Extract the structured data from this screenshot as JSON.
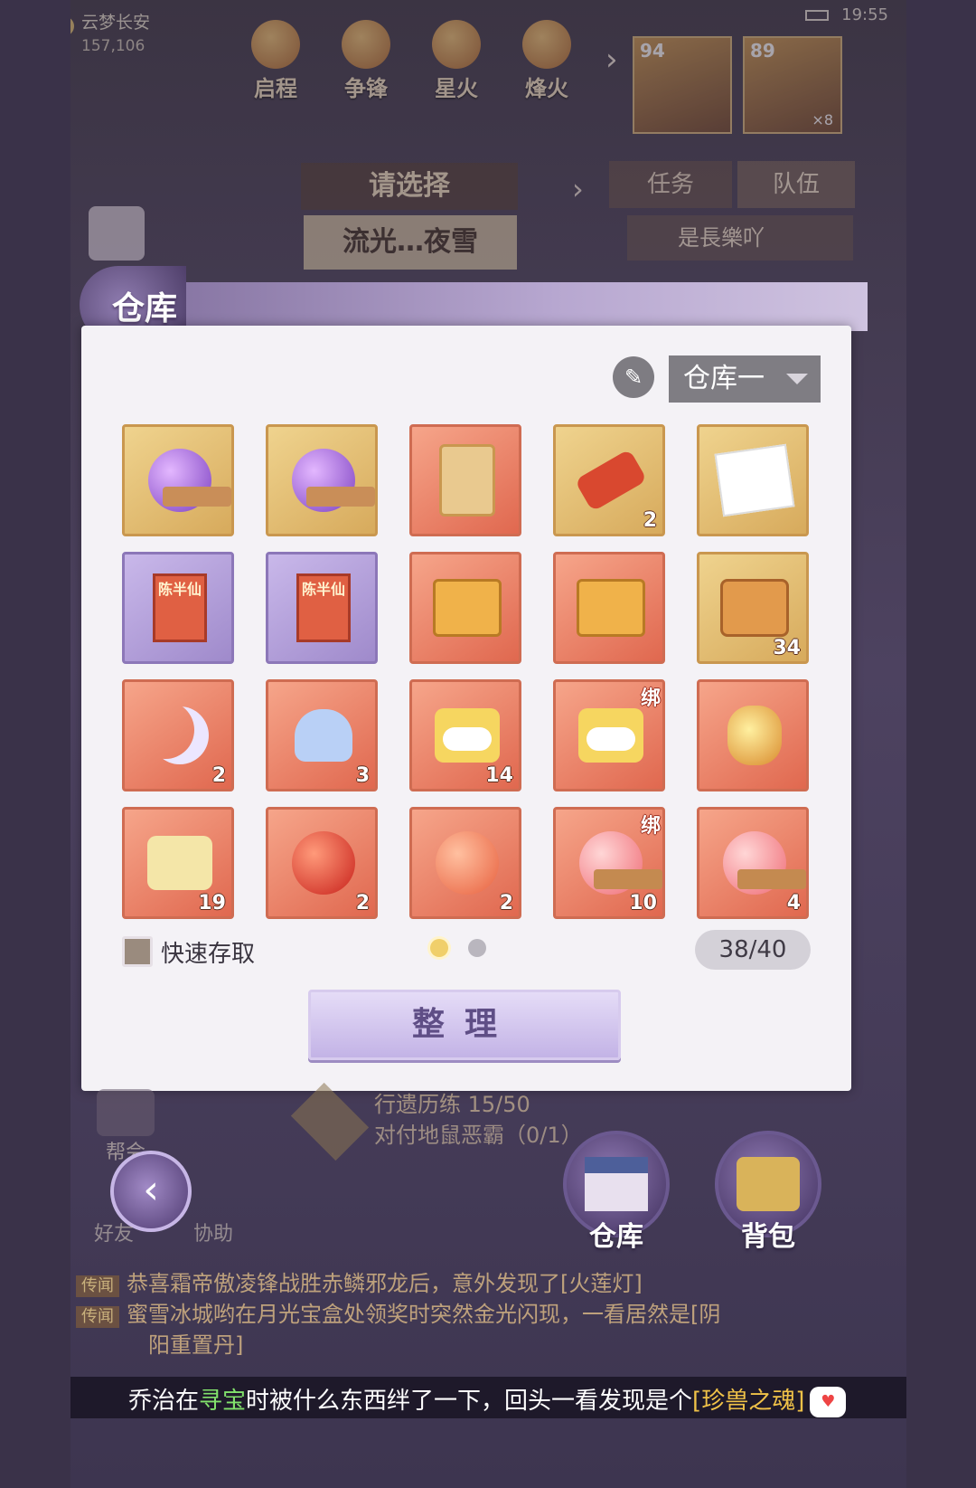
{
  "hud": {
    "map_name": "云梦长安",
    "map_coord": "157,106",
    "clock": "19:55",
    "activities": [
      {
        "label": "启程",
        "icon": "scroll-icon"
      },
      {
        "label": "争锋",
        "icon": "flag-icon"
      },
      {
        "label": "星火",
        "icon": "flame-icon"
      },
      {
        "label": "烽火",
        "icon": "beacon-icon"
      }
    ],
    "portraits": [
      {
        "level": "94",
        "count": ""
      },
      {
        "level": "89",
        "count": "×8"
      }
    ]
  },
  "behind": {
    "select_label": "请选择",
    "select_value": "流光…夜雪",
    "tab_task": "任务",
    "tab_team": "队伍",
    "team_member": "是長樂吖"
  },
  "dialog": {
    "title": "仓库",
    "warehouse_select": "仓库一",
    "quick_access_label": "快速存取",
    "capacity": "38/40",
    "sort_button": "整理",
    "page_count": 2,
    "active_page": 1,
    "items": [
      {
        "frame": "gold",
        "icon": "purple-orb-icon",
        "count": "",
        "bound": ""
      },
      {
        "frame": "gold",
        "icon": "purple-orb-icon",
        "count": "",
        "bound": ""
      },
      {
        "frame": "red",
        "icon": "character-card-icon",
        "count": "",
        "bound": ""
      },
      {
        "frame": "gold",
        "icon": "firecracker-icon",
        "count": "2",
        "bound": ""
      },
      {
        "frame": "gold",
        "icon": "photo-icon",
        "count": "",
        "bound": ""
      },
      {
        "frame": "purple",
        "icon": "red-book-icon",
        "count": "",
        "bound": "",
        "book_text": "陈半仙"
      },
      {
        "frame": "purple",
        "icon": "red-book-icon",
        "count": "",
        "bound": "",
        "book_text": "陈半仙"
      },
      {
        "frame": "red",
        "icon": "gift-box-icon",
        "count": "",
        "bound": ""
      },
      {
        "frame": "red",
        "icon": "gift-box-icon",
        "count": "",
        "bound": ""
      },
      {
        "frame": "gold",
        "icon": "treasure-chest-icon",
        "count": "34",
        "bound": ""
      },
      {
        "frame": "red",
        "icon": "moon-pendant-icon",
        "count": "2",
        "bound": ""
      },
      {
        "frame": "red",
        "icon": "jelly-charm-icon",
        "count": "3",
        "bound": ""
      },
      {
        "frame": "red",
        "icon": "cloud-puzzle-icon",
        "count": "14",
        "bound": ""
      },
      {
        "frame": "red",
        "icon": "cloud-puzzle-icon",
        "count": "",
        "bound": "绑"
      },
      {
        "frame": "red",
        "icon": "amber-gem-icon",
        "count": "",
        "bound": ""
      },
      {
        "frame": "red",
        "icon": "bunny-puzzle-icon",
        "count": "19",
        "bound": ""
      },
      {
        "frame": "red",
        "icon": "fire-orb-icon",
        "count": "2",
        "bound": ""
      },
      {
        "frame": "red",
        "icon": "peach-orb-icon",
        "count": "2",
        "bound": ""
      },
      {
        "frame": "red",
        "icon": "paw-orb-icon",
        "count": "10",
        "bound": "绑"
      },
      {
        "frame": "red",
        "icon": "paw-orb-icon",
        "count": "4",
        "bound": ""
      }
    ]
  },
  "lower": {
    "guild_label": "帮会",
    "quest_title": "行遗历练 15/50",
    "quest_sub": "对付地鼠恶霸（0/1）",
    "friend_label": "好友",
    "assist_label": "协助",
    "warehouse_btn": "仓库",
    "backpack_btn": "背包"
  },
  "chat": [
    {
      "tag": "传闻",
      "text": "恭喜霜帝傲凌锋战胜赤鳞邪龙后，意外发现了[火莲灯]"
    },
    {
      "tag": "传闻",
      "text": "蜜雪冰城哟在月光宝盒处领奖时突然金光闪现，一看居然是[阴"
    },
    {
      "tag": "",
      "text": "阳重置丹]"
    }
  ],
  "bottom_msg": {
    "pre": "乔治在",
    "g": "寻宝",
    "mid": "时被什么东西绊了一下，回头一看发现是个",
    "y": "[珍兽之魂]"
  }
}
